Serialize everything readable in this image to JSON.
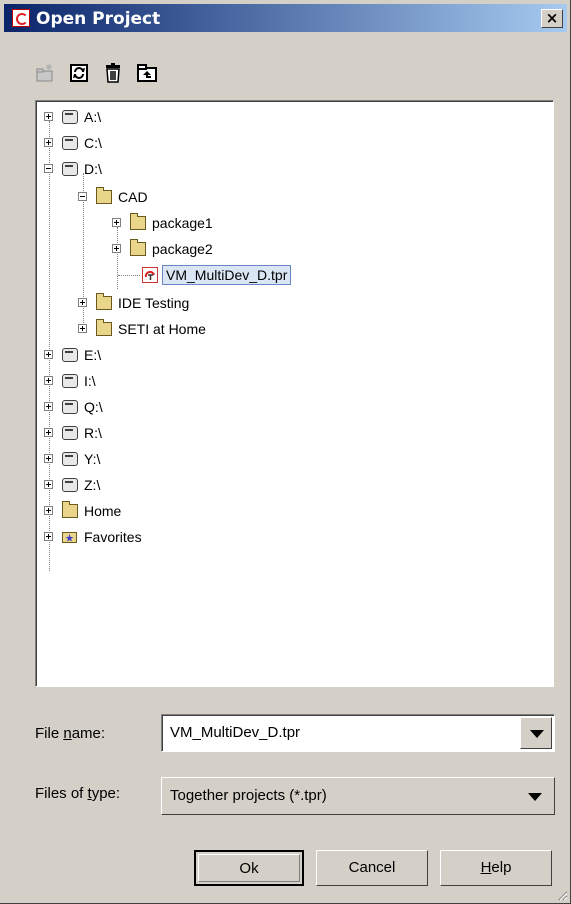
{
  "window": {
    "title": "Open Project",
    "close_label": "×"
  },
  "toolbar": {
    "icons": [
      "new-folder-icon",
      "refresh-icon",
      "delete-icon",
      "up-folder-icon"
    ]
  },
  "tree": {
    "nodes": [
      {
        "label": "A:\\",
        "icon": "drive-icon",
        "expander": "plus"
      },
      {
        "label": "C:\\",
        "icon": "drive-icon",
        "expander": "plus"
      },
      {
        "label": "D:\\",
        "icon": "drive-icon",
        "expander": "minus"
      },
      {
        "label": "CAD",
        "icon": "open-folder-icon",
        "expander": "minus"
      },
      {
        "label": "package1",
        "icon": "folder-icon",
        "expander": "plus"
      },
      {
        "label": "package2",
        "icon": "folder-icon",
        "expander": "plus"
      },
      {
        "label": "VM_MultiDev_D.tpr",
        "icon": "project-file-icon",
        "expander": "none",
        "selected": true
      },
      {
        "label": "IDE Testing",
        "icon": "folder-icon",
        "expander": "plus"
      },
      {
        "label": "SETI at Home",
        "icon": "folder-icon",
        "expander": "plus"
      },
      {
        "label": "E:\\",
        "icon": "drive-icon",
        "expander": "plus"
      },
      {
        "label": "I:\\",
        "icon": "drive-icon",
        "expander": "plus"
      },
      {
        "label": "Q:\\",
        "icon": "drive-icon",
        "expander": "plus"
      },
      {
        "label": "R:\\",
        "icon": "drive-icon",
        "expander": "plus"
      },
      {
        "label": "Y:\\",
        "icon": "drive-icon",
        "expander": "plus"
      },
      {
        "label": "Z:\\",
        "icon": "drive-icon",
        "expander": "plus"
      },
      {
        "label": "Home",
        "icon": "folder-icon",
        "expander": "plus"
      },
      {
        "label": "Favorites",
        "icon": "favorites-folder-icon",
        "expander": "plus"
      }
    ]
  },
  "file_name": {
    "label_pre": "File ",
    "label_u": "n",
    "label_post": "ame:",
    "value": "VM_MultiDev_D.tpr"
  },
  "file_type": {
    "label_pre": "Files of ",
    "label_u": "t",
    "label_post": "ype:",
    "value": "Together projects (*.tpr)"
  },
  "buttons": {
    "ok": "Ok",
    "cancel": "Cancel",
    "help_u": "H",
    "help_rest": "elp"
  },
  "colors": {
    "title_start": "#0a246a",
    "title_end": "#a6caf0",
    "face": "#d4d0c8",
    "selection": "#dbe6f5"
  }
}
